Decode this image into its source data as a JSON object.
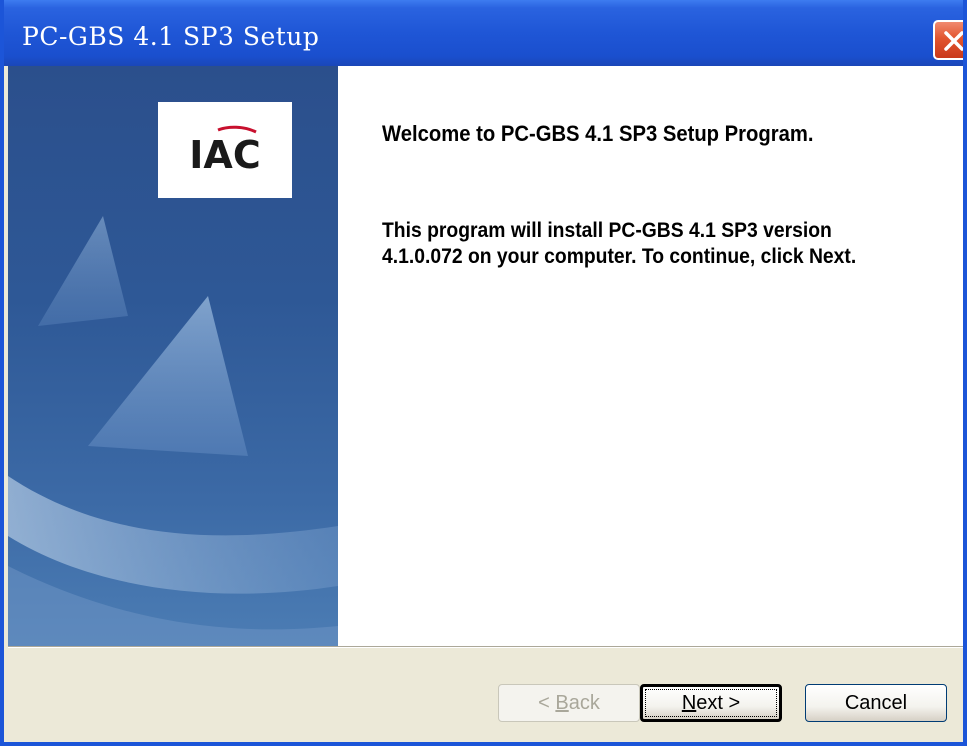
{
  "window": {
    "title": "PC-GBS 4.1 SP3 Setup"
  },
  "logo": {
    "text": "IAC"
  },
  "content": {
    "heading": "Welcome to PC-GBS 4.1 SP3 Setup Program.",
    "body": "This program will install PC-GBS 4.1 SP3 version 4.1.0.072 on your computer. To continue, click Next."
  },
  "buttons": {
    "back": {
      "label_pre": "< ",
      "label_accel": "B",
      "label_post": "ack",
      "enabled": false
    },
    "next": {
      "label_pre": "",
      "label_accel": "N",
      "label_post": "ext >",
      "enabled": true
    },
    "cancel": {
      "label": "Cancel",
      "enabled": true
    }
  },
  "colors": {
    "titlebar": "#1f56d6",
    "close_button": "#e2552f",
    "side_panel": "#2e5896",
    "dialog_face": "#ece9d8"
  },
  "icons": {
    "close": "close-icon"
  }
}
